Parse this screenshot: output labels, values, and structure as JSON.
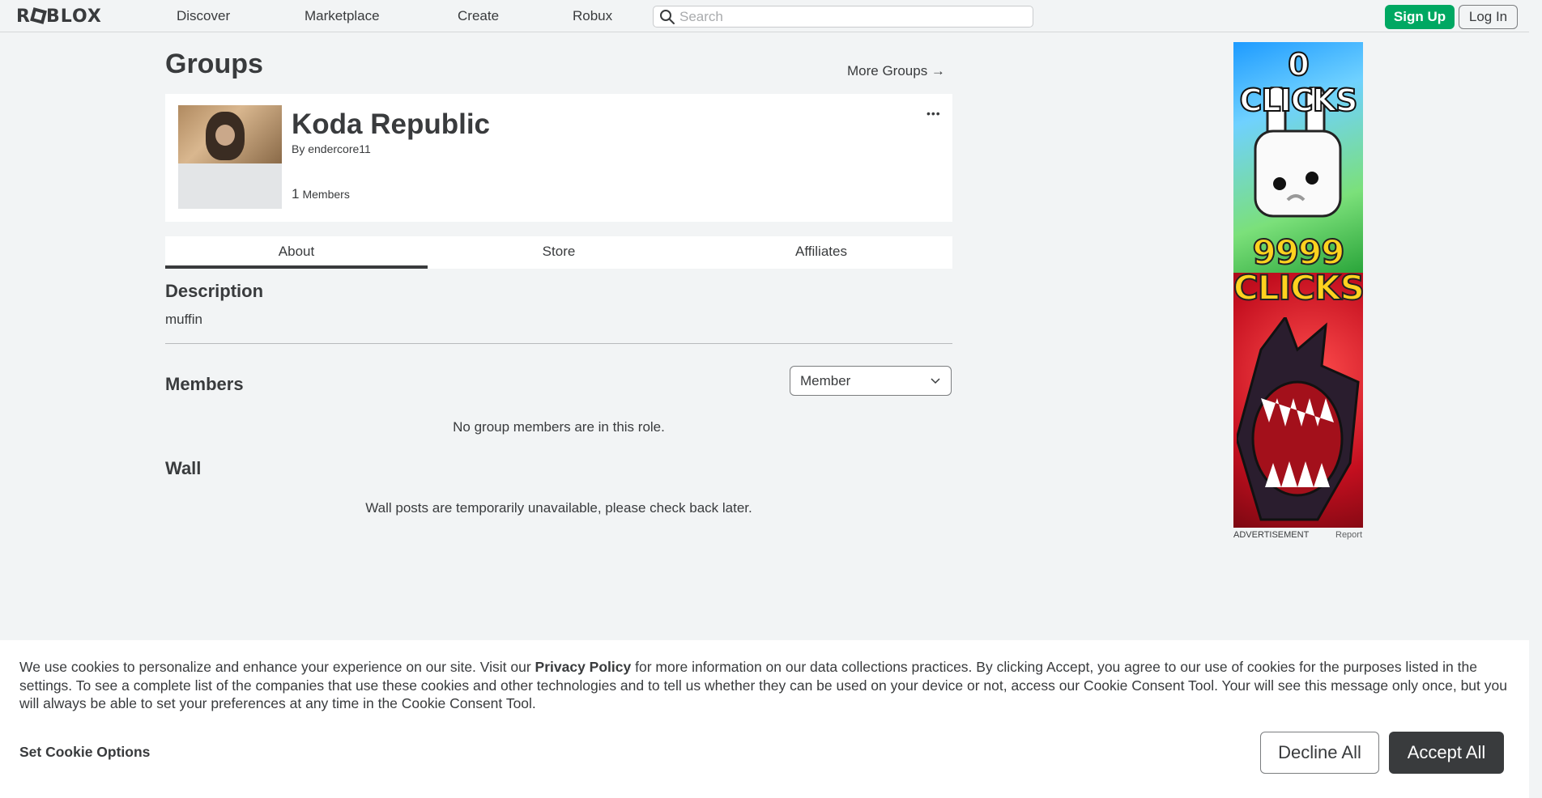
{
  "nav": {
    "logo": "ROBLOX",
    "links": [
      "Discover",
      "Marketplace",
      "Create",
      "Robux"
    ],
    "search_placeholder": "Search",
    "signup_label": "Sign Up",
    "login_label": "Log In"
  },
  "page": {
    "title": "Groups",
    "more_groups": "More Groups →"
  },
  "group": {
    "name": "Koda Republic",
    "by_prefix": "By",
    "owner": "endercore11",
    "member_count": "1",
    "member_label": "Members",
    "more_menu": "•••"
  },
  "tabs": [
    "About",
    "Store",
    "Affiliates"
  ],
  "about": {
    "description_heading": "Description",
    "description_text": "muffin",
    "members_heading": "Members",
    "role_selected": "Member",
    "no_members_msg": "No group members are in this role.",
    "wall_heading": "Wall",
    "wall_msg": "Wall posts are temporarily unavailable, please check back later."
  },
  "ad": {
    "headline_top": "0 CLICKS",
    "headline_mid_1": "9999",
    "headline_mid_2": "CLICKS",
    "label": "ADVERTISEMENT",
    "report": "Report"
  },
  "cookie": {
    "text_before": "We use cookies to personalize and enhance your experience on our site. Visit our ",
    "policy_link": "Privacy Policy",
    "text_after": " for more information on our data collections practices. By clicking Accept, you agree to our use of cookies for the purposes listed in the settings. To see a complete list of the companies that use these cookies and other technologies and to tell us whether they can be used on your device or not, access our Cookie Consent Tool. Your will see this message only once, but you will always be able to set your preferences at any time in the Cookie Consent Tool.",
    "set_options": "Set Cookie Options",
    "decline": "Decline All",
    "accept": "Accept All"
  },
  "colors": {
    "signup_green": "#00a862",
    "text_dark": "#393b3d",
    "accept_bg": "#393b3d"
  }
}
